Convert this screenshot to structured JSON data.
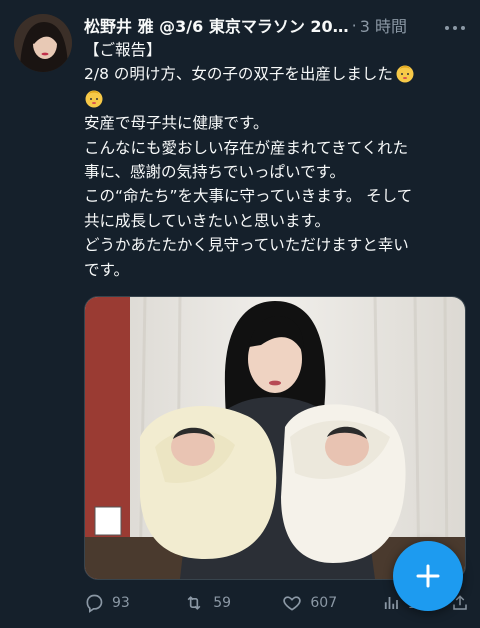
{
  "tweet": {
    "display_name": "松野井 雅 @3/6 東京マラソン 20…",
    "separator": "·",
    "time": "3 時間",
    "text_lines": [
      "【ご報告】",
      "2/8 の明け方、女の子の双子を出産しました",
      "",
      "安産で母子共に健康です。",
      "こんなにも愛おしい存在が産まれてきてくれた",
      "事に、感謝の気持ちでいっぱいです。",
      "この“命たち”を大事に守っていきます。 そして",
      "共に成長していきたいと思います。",
      "どうかあたたかく見守っていただけますと幸い",
      "です。"
    ],
    "emoji_name": "baby-emoji"
  },
  "actions": {
    "reply_count": "93",
    "retweet_count": "59",
    "like_count": "607",
    "view_count": "1万"
  },
  "colors": {
    "background": "#15202b",
    "text": "#f7f9f9",
    "muted": "#8b98a5",
    "accent": "#1d9bf0"
  },
  "icons": {
    "reply": "reply-icon",
    "retweet": "retweet-icon",
    "like": "heart-icon",
    "views": "views-icon",
    "share": "share-icon",
    "more": "more-icon",
    "compose": "plus-icon"
  }
}
